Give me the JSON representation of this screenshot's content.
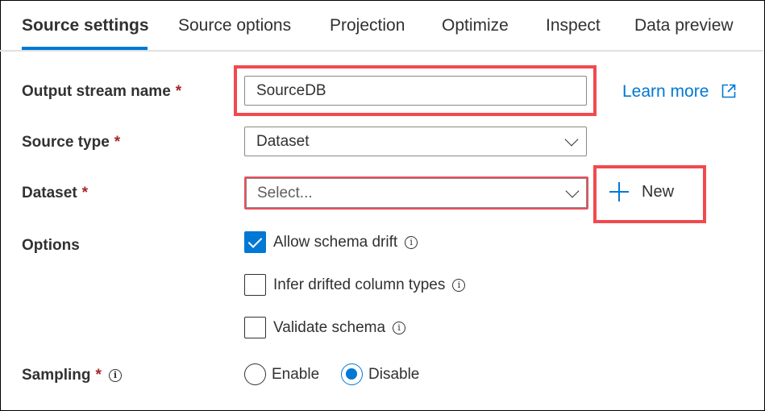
{
  "tabs": [
    {
      "label": "Source settings",
      "active": true
    },
    {
      "label": "Source options",
      "active": false
    },
    {
      "label": "Projection",
      "active": false
    },
    {
      "label": "Optimize",
      "active": false
    },
    {
      "label": "Inspect",
      "active": false
    },
    {
      "label": "Data preview",
      "active": false
    }
  ],
  "form": {
    "output_stream_name": {
      "label": "Output stream name",
      "required_mark": "*",
      "value": "SourceDB"
    },
    "learn_more": {
      "label": "Learn more",
      "icon": "external-link-icon"
    },
    "source_type": {
      "label": "Source type",
      "required_mark": "*",
      "value": "Dataset"
    },
    "dataset": {
      "label": "Dataset",
      "required_mark": "*",
      "placeholder": "Select..."
    },
    "new_button": {
      "label": "New",
      "icon": "plus-icon"
    },
    "options": {
      "label": "Options",
      "items": [
        {
          "label": "Allow schema drift",
          "checked": true,
          "info": "i"
        },
        {
          "label": "Infer drifted column types",
          "checked": false,
          "info": "i"
        },
        {
          "label": "Validate schema",
          "checked": false,
          "info": "i"
        }
      ]
    },
    "sampling": {
      "label": "Sampling",
      "required_mark": "*",
      "info": "i",
      "options": [
        {
          "label": "Enable",
          "selected": false
        },
        {
          "label": "Disable",
          "selected": true
        }
      ]
    }
  },
  "colors": {
    "accent": "#0078d4",
    "highlight": "#f04a4e",
    "required": "#a4262c"
  }
}
